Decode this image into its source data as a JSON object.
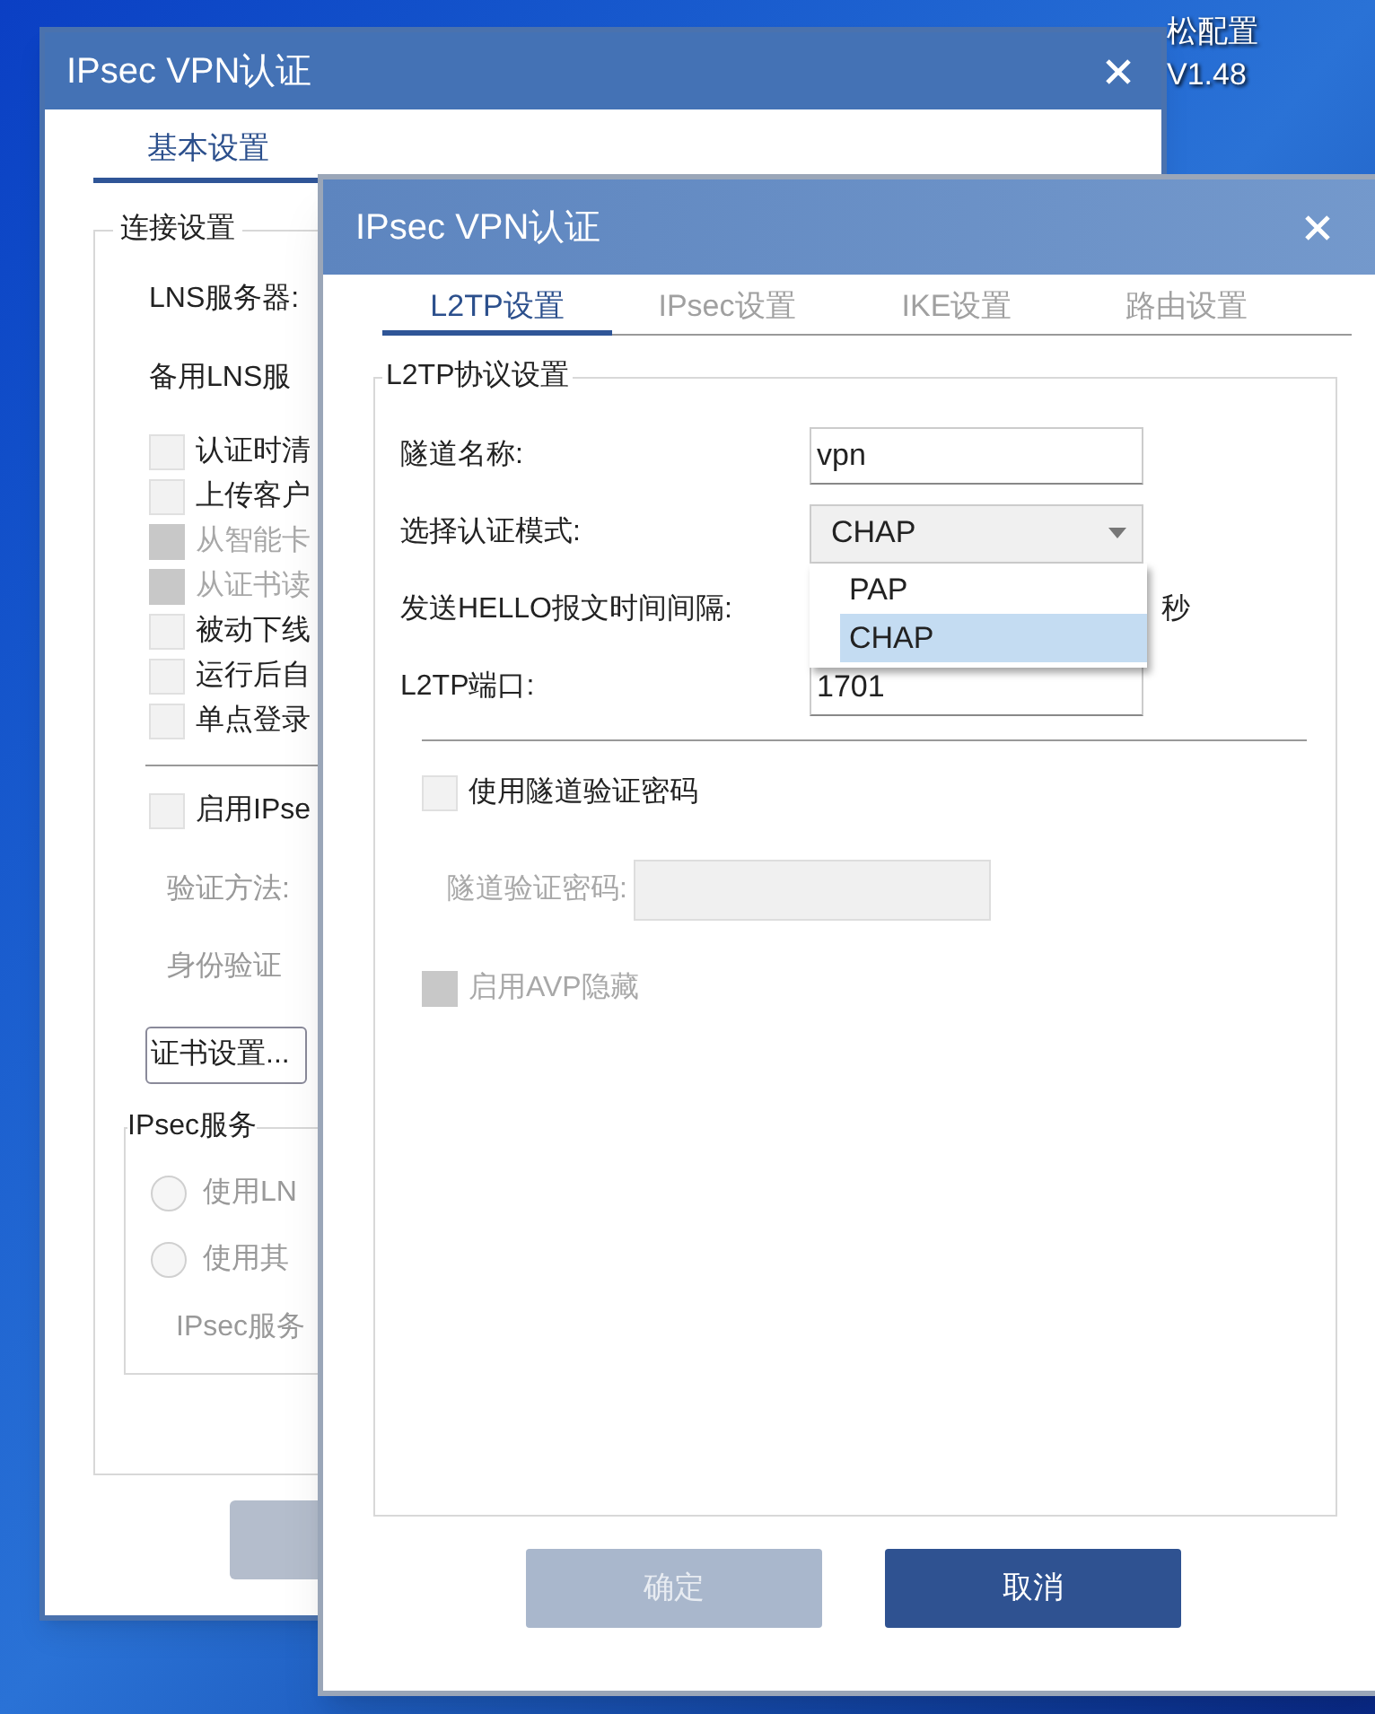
{
  "desktop": {
    "labels": [
      "松配置",
      "V1.48"
    ]
  },
  "back_window": {
    "title": "IPsec VPN认证",
    "tabs": [
      {
        "label": "基本设置",
        "selected": true
      }
    ],
    "group": {
      "title": "连接设置",
      "fields": [
        "LNS服务器:",
        "备用LNS服"
      ],
      "checkboxes": [
        {
          "label": "认证时清",
          "checked": false,
          "disabled": false
        },
        {
          "label": "上传客户",
          "checked": false,
          "disabled": false
        },
        {
          "label": "从智能卡",
          "checked": false,
          "disabled": true
        },
        {
          "label": "从证书读",
          "checked": false,
          "disabled": true
        },
        {
          "label": "被动下线",
          "checked": false,
          "disabled": false
        },
        {
          "label": "运行后自",
          "checked": false,
          "disabled": false
        },
        {
          "label": "单点登录",
          "checked": false,
          "disabled": false
        }
      ],
      "ipsec_checkbox": {
        "label": "启用IPse",
        "checked": false
      },
      "method_label": "验证方法:",
      "identity_label": "身份验证",
      "cert_button": "证书设置...",
      "server_group": {
        "title": "IPsec服务",
        "radios": [
          {
            "label": "使用LN",
            "selected": false
          },
          {
            "label": "使用其",
            "selected": false
          }
        ],
        "address_label": "IPsec服务"
      }
    }
  },
  "front_window": {
    "title": "IPsec VPN认证",
    "tabs": [
      {
        "label": "L2TP设置",
        "selected": true
      },
      {
        "label": "IPsec设置",
        "selected": false
      },
      {
        "label": "IKE设置",
        "selected": false
      },
      {
        "label": "路由设置",
        "selected": false
      }
    ],
    "group": {
      "title": "L2TP协议设置",
      "tunnel_name": {
        "label": "隧道名称:",
        "value": "vpn"
      },
      "auth_mode": {
        "label": "选择认证模式:",
        "value": "CHAP",
        "expanded": true,
        "options": [
          {
            "label": "PAP",
            "selected": false
          },
          {
            "label": "CHAP",
            "selected": true
          }
        ]
      },
      "hello_interval": {
        "label": "发送HELLO报文时间间隔:",
        "unit": "秒"
      },
      "port": {
        "label": "L2TP端口:",
        "value": "1701"
      },
      "tunnel_password_checkbox": {
        "label": "使用隧道验证密码",
        "checked": false
      },
      "tunnel_password": {
        "label": "隧道验证密码:",
        "disabled": true
      },
      "avp_checkbox": {
        "label": "启用AVP隐藏",
        "checked": false,
        "disabled": true
      }
    },
    "buttons": [
      {
        "label": "确定",
        "disabled": true
      },
      {
        "label": "取消",
        "disabled": false
      }
    ]
  }
}
